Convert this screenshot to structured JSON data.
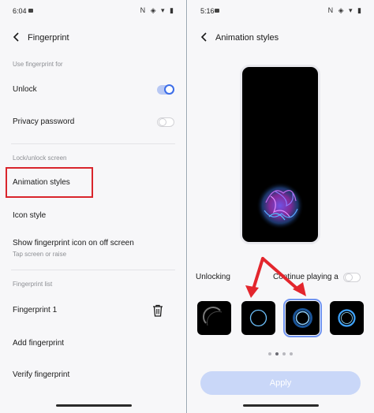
{
  "left": {
    "status": {
      "time": "6:04",
      "icons": "N ◈ ▾ ▮"
    },
    "header": {
      "title": "Fingerprint"
    },
    "section_unlock": "Use fingerprint for",
    "unlock": {
      "label": "Unlock",
      "enabled": true
    },
    "privacy": {
      "label": "Privacy password",
      "enabled": false
    },
    "section_lock": "Lock/unlock screen",
    "animation_styles": {
      "label": "Animation styles"
    },
    "icon_style": {
      "label": "Icon style"
    },
    "show_icon": {
      "label": "Show fingerprint icon on off screen",
      "sub": "Tap screen or raise"
    },
    "section_list": "Fingerprint list",
    "fingerprint1": {
      "label": "Fingerprint 1"
    },
    "add_fingerprint": {
      "label": "Add fingerprint"
    },
    "verify_fingerprint": {
      "label": "Verify fingerprint"
    }
  },
  "right": {
    "status": {
      "time": "5:16",
      "icons": "N ◈ ▾ ▮"
    },
    "header": {
      "title": "Animation styles"
    },
    "unlocking_label": "Unlocking",
    "continue_label": "Continue playing a",
    "continue_enabled": false,
    "thumbnails": [
      "style-1",
      "style-2",
      "style-3",
      "style-4"
    ],
    "selected_thumbnail": 2,
    "pager": {
      "count": 4,
      "active": 1
    },
    "apply_label": "Apply"
  },
  "colors": {
    "accent": "#3d6ee8",
    "highlight": "#d9252c",
    "apply_bg": "#c9d7f8"
  }
}
